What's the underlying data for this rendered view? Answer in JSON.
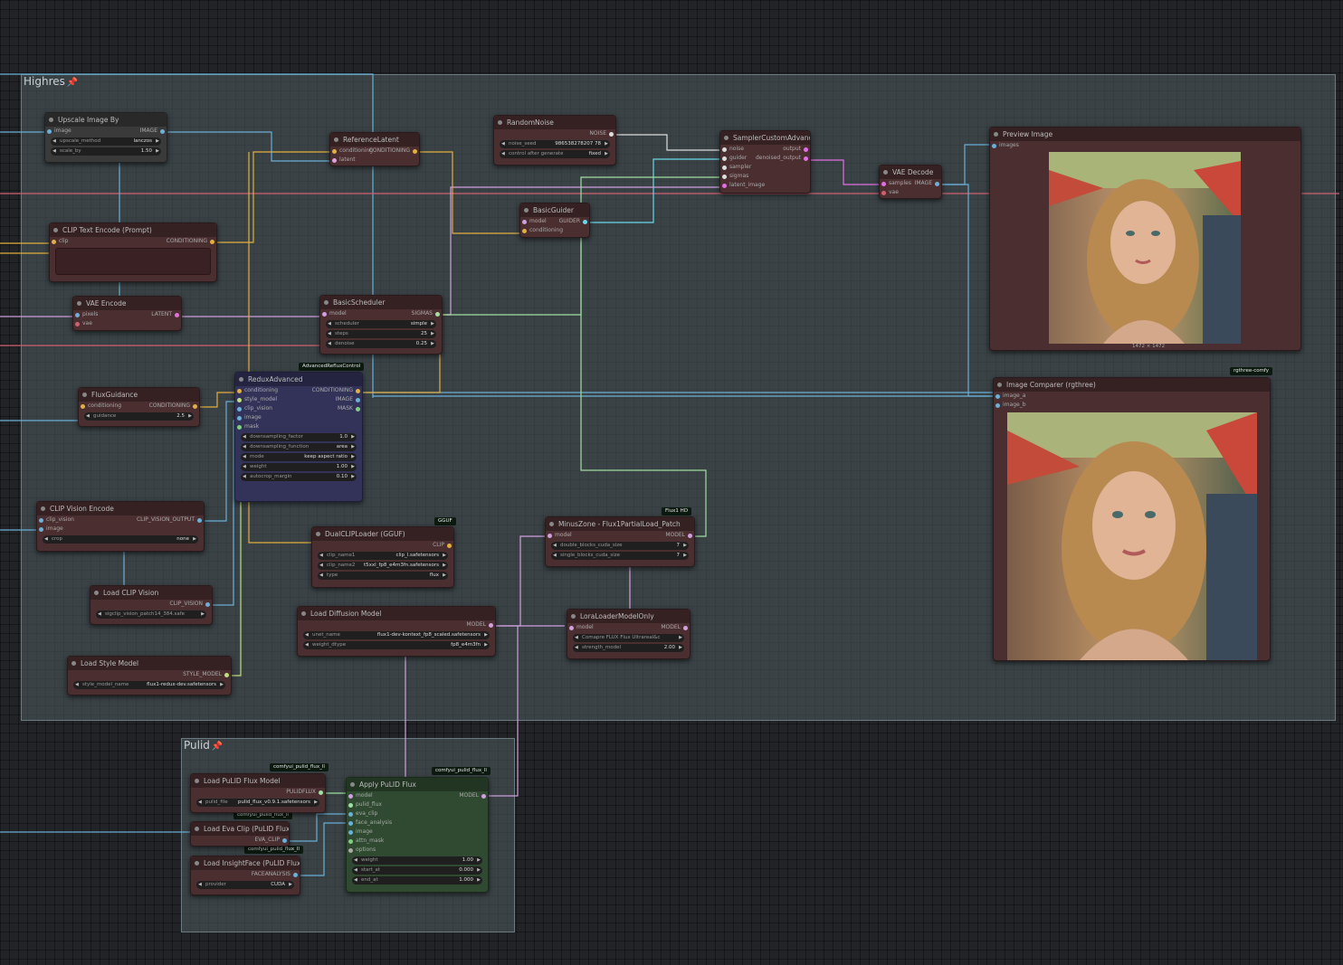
{
  "groups": {
    "highres": "Highres",
    "pulid": "Pulid"
  },
  "badges": {
    "advanced_reflux": "AdvancedRefluxControl",
    "gguf": "GGUF",
    "flux1_hd": "Flux1 HD",
    "rgthree": "rgthree-comfy",
    "pulid1": "comfyui_pulid_flux_ll",
    "pulid2": "comfyui_pulid_flux_ll",
    "pulid3": "comfyui_pulid_flux_ll",
    "pulid4": "comfyui_pulid_flux_ll"
  },
  "nodes": {
    "upscale": {
      "title": "Upscale Image By",
      "in_image": "image",
      "out": "IMAGE",
      "w1_label": "upscale_method",
      "w1_val": "lanczos",
      "w2_label": "scale_by",
      "w2_val": "1.50"
    },
    "reference_latent": {
      "title": "ReferenceLatent",
      "in1": "conditioning",
      "out": "CONDITIONING",
      "in2": "latent"
    },
    "random_noise": {
      "title": "RandomNoise",
      "out": "NOISE",
      "w1_label": "noise_seed",
      "w1_val": "986538278207 78",
      "w2_label": "control after generate",
      "w2_val": "fixed"
    },
    "sampler_custom": {
      "title": "SamplerCustomAdvanced",
      "in1": "noise",
      "in2": "guider",
      "in3": "sampler",
      "in4": "sigmas",
      "in5": "latent_image",
      "out1": "output",
      "out2": "denoised_output"
    },
    "vae_decode": {
      "title": "VAE Decode",
      "in1": "samples",
      "in2": "vae",
      "out": "IMAGE"
    },
    "preview": {
      "title": "Preview Image",
      "in1": "images",
      "caption": "1472 × 1472"
    },
    "clip_text": {
      "title": "CLIP Text Encode (Prompt)",
      "in1": "clip",
      "out": "CONDITIONING"
    },
    "basic_guider": {
      "title": "BasicGuider",
      "in1": "model",
      "in2": "conditioning",
      "out": "GUIDER"
    },
    "vae_encode": {
      "title": "VAE Encode",
      "in1": "pixels",
      "in2": "vae",
      "out": "LATENT"
    },
    "basic_scheduler": {
      "title": "BasicScheduler",
      "in1": "model",
      "out": "SIGMAS",
      "w1_label": "scheduler",
      "w1_val": "simple",
      "w2_label": "steps",
      "w2_val": "25",
      "w3_label": "denoise",
      "w3_val": "0.25"
    },
    "flux_guidance": {
      "title": "FluxGuidance",
      "in1": "conditioning",
      "out": "CONDITIONING",
      "w1_label": "guidance",
      "w1_val": "2.5"
    },
    "redux": {
      "title": "ReduxAdvanced",
      "in1": "conditioning",
      "in2": "style_model",
      "in3": "clip_vision",
      "in4": "image",
      "in5": "mask",
      "out1": "CONDITIONING",
      "out2": "IMAGE",
      "out3": "MASK",
      "w1_label": "downsampling_factor",
      "w1_val": "1.0",
      "w2_label": "downsampling_function",
      "w2_val": "area",
      "w3_label": "mode",
      "w3_val": "keep aspect ratio",
      "w4_label": "weight",
      "w4_val": "1.00",
      "w5_label": "autocrop_margin",
      "w5_val": "0.10"
    },
    "image_comparer": {
      "title": "Image Comparer (rgthree)",
      "in1": "image_a",
      "in2": "image_b"
    },
    "clip_vision_encode": {
      "title": "CLIP Vision Encode",
      "in1": "clip_vision",
      "in2": "image",
      "out": "CLIP_VISION_OUTPUT",
      "w1_label": "crop",
      "w1_val": "none"
    },
    "dual_clip": {
      "title": "DualCLIPLoader (GGUF)",
      "out": "CLIP",
      "w1_label": "clip_name1",
      "w1_val": "clip_l.safetensors",
      "w2_label": "clip_name2",
      "w2_val": "t5xxl_fp8_e4m3fn.safetensors",
      "w3_label": "type",
      "w3_val": "flux"
    },
    "minus_zone": {
      "title": "MinusZone - Flux1PartialLoad_Patch",
      "in1": "model",
      "out": "MODEL",
      "w1_label": "double_blocks_cuda_size",
      "w1_val": "7",
      "w2_label": "single_blocks_cuda_size",
      "w2_val": "7"
    },
    "load_clip_vision": {
      "title": "Load CLIP Vision",
      "out": "CLIP_VISION",
      "w1_label": "sigclip_vision_patch14_384.safe",
      "w1_val": ""
    },
    "load_diffusion": {
      "title": "Load Diffusion Model",
      "out": "MODEL",
      "w1_label": "unet_name",
      "w1_val": "flux1-dev-kontext_fp8_scaled.safetensors",
      "w2_label": "weight_dtype",
      "w2_val": "fp8_e4m3fn"
    },
    "lora_loader": {
      "title": "LoraLoaderModelOnly",
      "in1": "model",
      "out": "MODEL",
      "w1_label": "Comapre FLUX Flux Ultrareal&c",
      "w1_val": "",
      "w2_label": "strength_model",
      "w2_val": "2.00"
    },
    "load_style": {
      "title": "Load Style Model",
      "out": "STYLE_MODEL",
      "w1_label": "style_model_name",
      "w1_val": "flux1-redux-dev.safetensors"
    },
    "load_pulid": {
      "title": "Load PuLID Flux Model",
      "out": "PULIDFLUX",
      "w1_label": "pulid_file",
      "w1_val": "pulid_flux_v0.9.1.safetensors"
    },
    "apply_pulid": {
      "title": "Apply PuLID Flux",
      "in1": "model",
      "in2": "pulid_flux",
      "in3": "eva_clip",
      "in4": "face_analysis",
      "in5": "image",
      "in6": "attn_mask",
      "in7": "options",
      "out": "MODEL",
      "w1_label": "weight",
      "w1_val": "1.00",
      "w2_label": "start_at",
      "w2_val": "0.000",
      "w3_label": "end_at",
      "w3_val": "1.000"
    },
    "load_eva": {
      "title": "Load Eva Clip (PuLID Flux)",
      "out": "EVA_CLIP"
    },
    "load_insight": {
      "title": "Load InsightFace (PuLID Flux)",
      "out": "FACEANALYSIS",
      "w1_label": "provider",
      "w1_val": "CUDA"
    }
  }
}
